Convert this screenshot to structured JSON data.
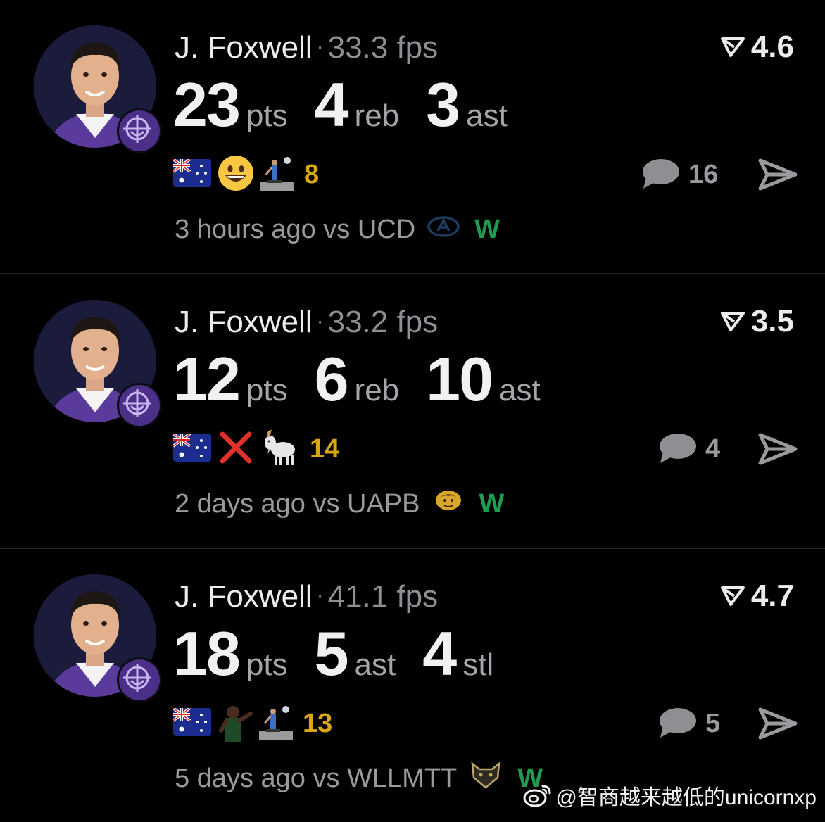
{
  "posts": [
    {
      "player": "J. Foxwell",
      "separator": "·",
      "fps": "33.3 fps",
      "rating": "4.6",
      "stats": [
        {
          "value": "23",
          "label": "pts"
        },
        {
          "value": "4",
          "label": "reb"
        },
        {
          "value": "3",
          "label": "ast"
        }
      ],
      "emojis": [
        "australia-flag",
        "grinning-face",
        "player-moon-sticker"
      ],
      "reaction_count": "8",
      "comment_count": "16",
      "time_ago": "3 hours ago vs UCD",
      "opponent_logo": "ucd-aggies-logo",
      "result": "W"
    },
    {
      "player": "J. Foxwell",
      "separator": "·",
      "fps": "33.2 fps",
      "rating": "3.5",
      "stats": [
        {
          "value": "12",
          "label": "pts"
        },
        {
          "value": "6",
          "label": "reb"
        },
        {
          "value": "10",
          "label": "ast"
        }
      ],
      "emojis": [
        "australia-flag",
        "cross-mark",
        "goat"
      ],
      "reaction_count": "14",
      "comment_count": "4",
      "time_ago": "2 days ago vs UAPB",
      "opponent_logo": "uapb-golden-lions-logo",
      "result": "W"
    },
    {
      "player": "J. Foxwell",
      "separator": "·",
      "fps": "41.1 fps",
      "rating": "4.7",
      "stats": [
        {
          "value": "18",
          "label": "pts"
        },
        {
          "value": "5",
          "label": "ast"
        },
        {
          "value": "4",
          "label": "stl"
        }
      ],
      "emojis": [
        "australia-flag",
        "player-celebration-sticker",
        "player-moon-sticker"
      ],
      "reaction_count": "13",
      "comment_count": "5",
      "time_ago": "5 days ago vs WLLMTT",
      "opponent_logo": "willamette-bearcats-logo",
      "result": "W"
    }
  ],
  "colors": {
    "background": "#000000",
    "primary_text": "#ececec",
    "secondary_text": "#8e8e93",
    "reactions": "#d9a614",
    "win": "#1f9b52",
    "team_purple": "#4b2f88"
  },
  "watermark": "@智商越来越低的unicornxp"
}
